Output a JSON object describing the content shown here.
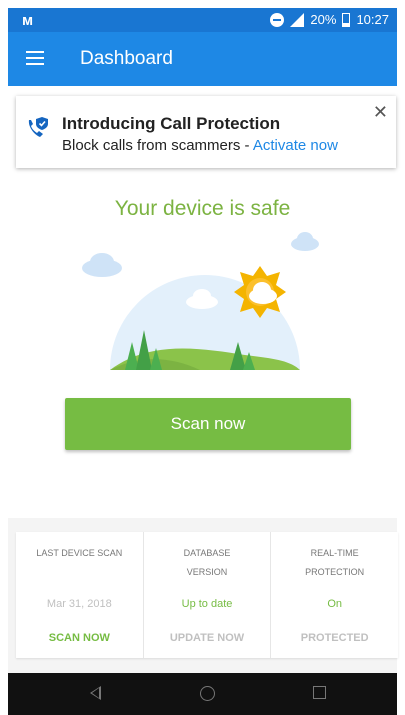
{
  "status_bar": {
    "app_icon": "malwarebytes-icon",
    "battery_pct": "20%",
    "time": "10:27"
  },
  "app_bar": {
    "title": "Dashboard",
    "menu_icon": "hamburger-icon"
  },
  "banner": {
    "title": "Introducing Call Protection",
    "subtitle": "Block calls from scammers - ",
    "link": "Activate now",
    "icon": "call-protection-icon",
    "close_icon": "close-icon"
  },
  "status": {
    "message": "Your device is safe"
  },
  "actions": {
    "scan_button": "Scan now"
  },
  "cards": [
    {
      "label": "Last device scan",
      "value": "Mar 31, 2018",
      "action": "SCAN NOW"
    },
    {
      "label": "Database version",
      "value": "Up to date",
      "action": "UPDATE NOW"
    },
    {
      "label": "Real-time protection",
      "value": "On",
      "action": "PROTECTED"
    }
  ],
  "colors": {
    "primary": "#1E88E5",
    "accent_green": "#76BC43",
    "safe_text": "#7CB342"
  }
}
